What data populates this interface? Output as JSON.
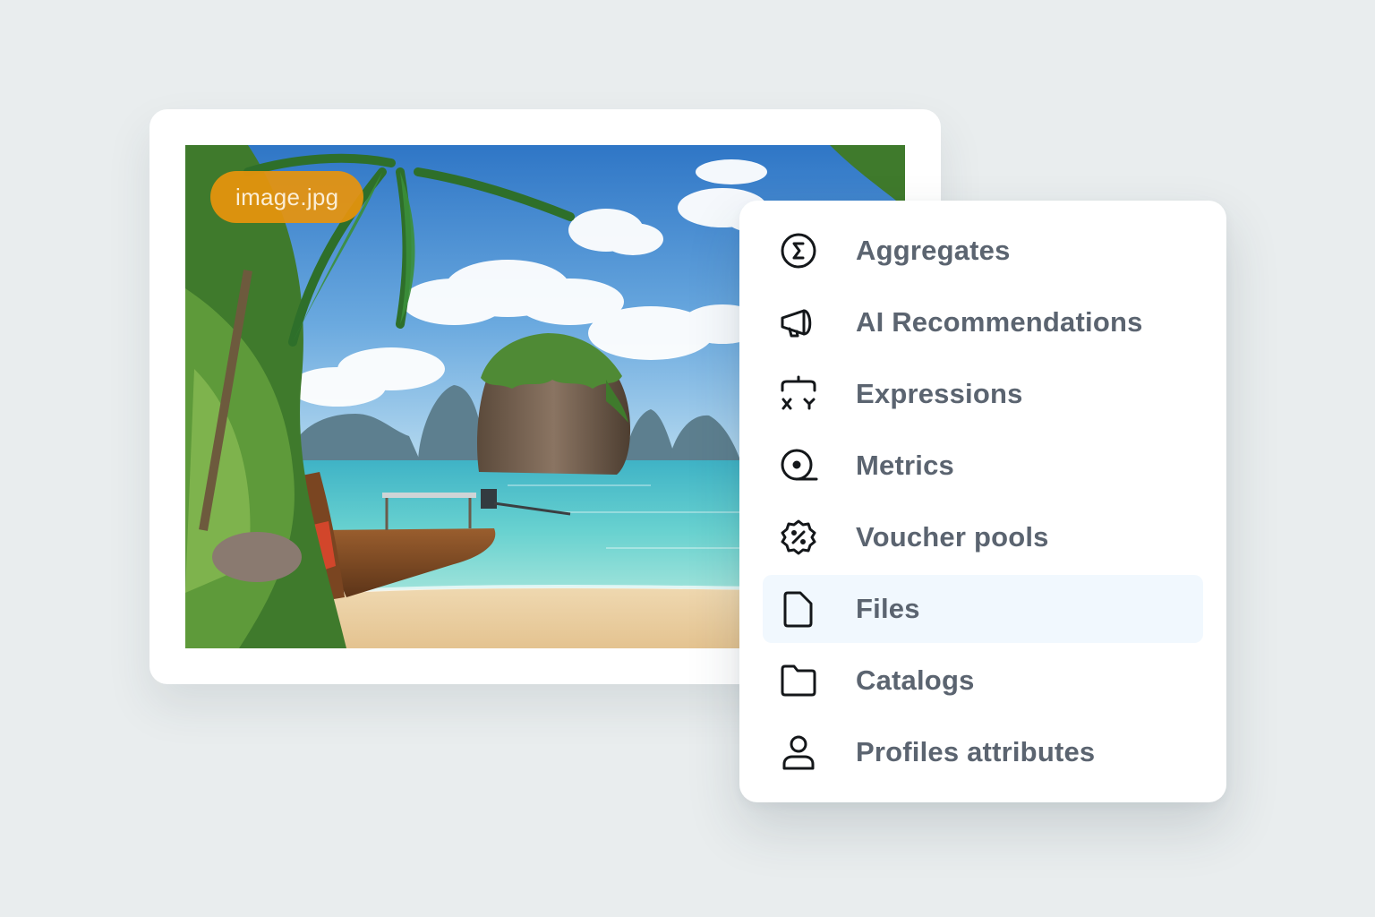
{
  "file_badge": {
    "label": "image.jpg"
  },
  "menu": {
    "items": [
      {
        "label": "Aggregates",
        "icon": "sigma-circle-icon"
      },
      {
        "label": "AI Recommendations",
        "icon": "megaphone-icon"
      },
      {
        "label": "Expressions",
        "icon": "xy-expression-icon"
      },
      {
        "label": "Metrics",
        "icon": "metric-roll-icon"
      },
      {
        "label": "Voucher pools",
        "icon": "discount-badge-icon"
      },
      {
        "label": "Files",
        "icon": "file-icon",
        "selected": true
      },
      {
        "label": "Catalogs",
        "icon": "folder-icon"
      },
      {
        "label": "Profiles attributes",
        "icon": "user-icon"
      }
    ]
  },
  "colors": {
    "background": "#e9edee",
    "badge": "#e8940c",
    "label": "#5b6470",
    "selected_row": "#f1f8fe"
  }
}
